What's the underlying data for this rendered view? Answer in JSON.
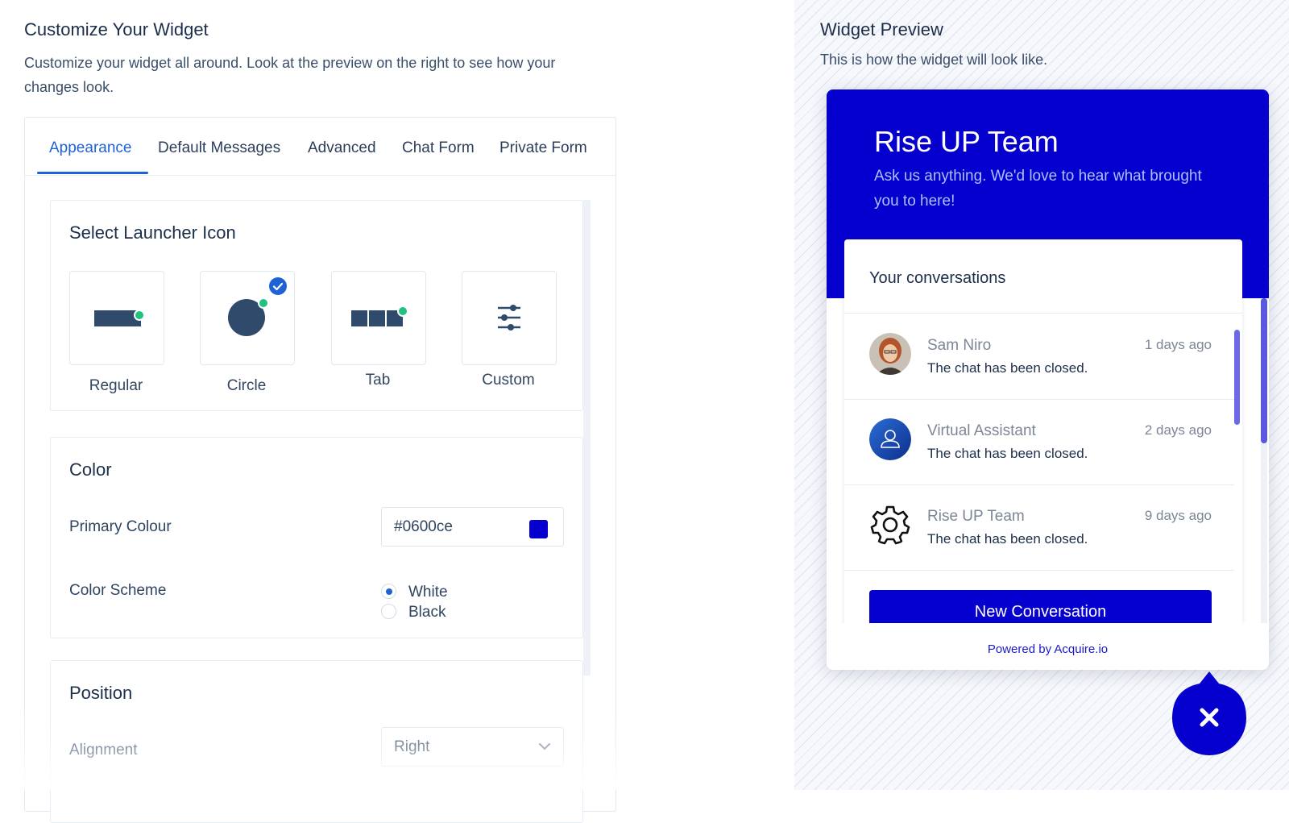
{
  "colors": {
    "primary": "#0600ce",
    "accent_blue": "#1f62d6",
    "online_dot": "#1fc27f",
    "icon_shape": "#2f4a6b"
  },
  "left": {
    "title": "Customize Your Widget",
    "description": "Customize your widget all around. Look at the preview on the right to see how your changes look.",
    "tabs": [
      {
        "label": "Appearance",
        "active": true
      },
      {
        "label": "Default Messages",
        "active": false
      },
      {
        "label": "Advanced",
        "active": false
      },
      {
        "label": "Chat Form",
        "active": false
      },
      {
        "label": "Private Form",
        "active": false
      }
    ],
    "launcher_section": {
      "title": "Select Launcher Icon",
      "options": [
        {
          "label": "Regular",
          "icon": "regular-launcher-icon",
          "selected": false
        },
        {
          "label": "Circle",
          "icon": "circle-launcher-icon",
          "selected": true
        },
        {
          "label": "Tab",
          "icon": "tab-launcher-icon",
          "selected": false
        },
        {
          "label": "Custom",
          "icon": "sliders-icon",
          "selected": false
        }
      ]
    },
    "color_section": {
      "title": "Color",
      "primary_label": "Primary Colour",
      "primary_value": "#0600ce",
      "scheme_label": "Color Scheme",
      "scheme_options": [
        {
          "label": "White",
          "checked": true
        },
        {
          "label": "Black",
          "checked": false
        }
      ]
    },
    "position_section": {
      "title": "Position",
      "alignment_label": "Alignment",
      "alignment_value": "Right"
    }
  },
  "right": {
    "title": "Widget Preview",
    "description": "This is how the widget will look like.",
    "widget": {
      "team_name": "Rise UP Team",
      "subtitle": "Ask us anything. We'd love to hear what brought you to here!",
      "conversations_title": "Your conversations",
      "conversations": [
        {
          "name": "Sam Niro",
          "time": "1 days ago",
          "message": "The chat has been closed.",
          "avatar": "photo-avatar"
        },
        {
          "name": "Virtual Assistant",
          "time": "2 days ago",
          "message": "The chat has been closed.",
          "avatar": "user-icon"
        },
        {
          "name": "Rise UP Team",
          "time": "9 days ago",
          "message": "The chat has been closed.",
          "avatar": "gear-icon"
        }
      ],
      "new_conversation_label": "New Conversation",
      "powered_by": "Powered by Acquire.io",
      "close_icon": "close-icon"
    }
  }
}
